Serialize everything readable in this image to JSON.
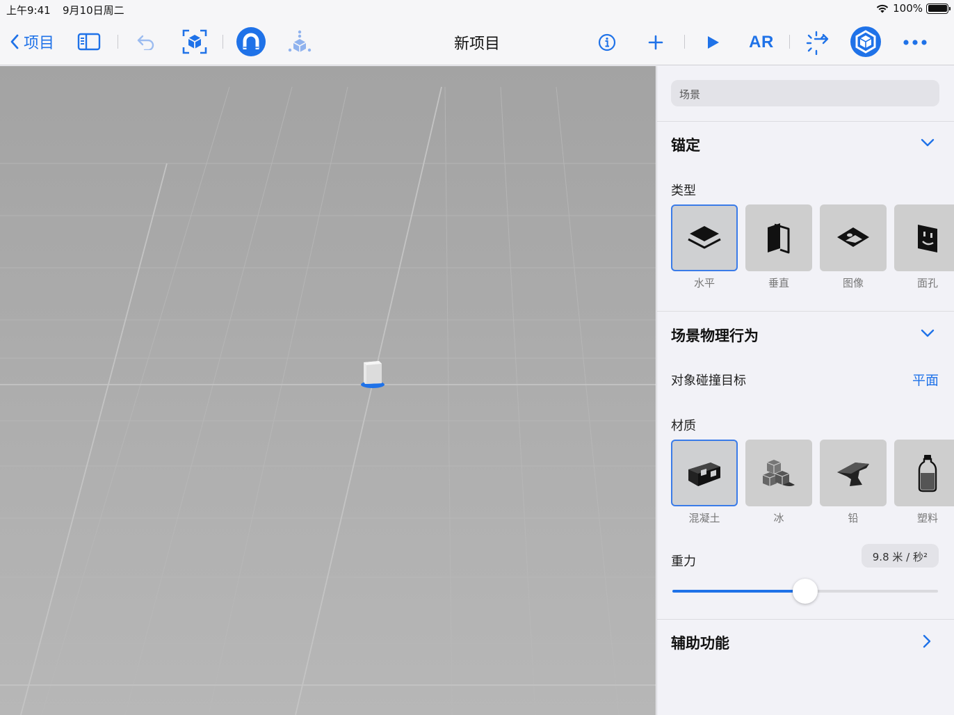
{
  "status_bar": {
    "time": "上午9:41",
    "date": "9月10日周二",
    "battery": "100%"
  },
  "toolbar": {
    "back_label": "项目",
    "title": "新项目",
    "ar_label": "AR",
    "accent": "#1f72e8"
  },
  "inspector": {
    "search_placeholder": "场景",
    "anchor_section": {
      "title": "锚定",
      "type_label": "类型",
      "types": [
        {
          "label": "水平",
          "icon": "horizontal-plane-icon",
          "selected": true
        },
        {
          "label": "垂直",
          "icon": "vertical-plane-icon",
          "selected": false
        },
        {
          "label": "图像",
          "icon": "image-anchor-icon",
          "selected": false
        },
        {
          "label": "面孔",
          "icon": "face-anchor-icon",
          "selected": false
        }
      ]
    },
    "physics_section": {
      "title": "场景物理行为",
      "collision_label": "对象碰撞目标",
      "collision_value": "平面",
      "material_label": "材质",
      "materials": [
        {
          "label": "混凝土",
          "icon": "concrete-block-icon",
          "selected": true
        },
        {
          "label": "冰",
          "icon": "ice-cubes-icon",
          "selected": false
        },
        {
          "label": "铅",
          "icon": "anvil-icon",
          "selected": false
        },
        {
          "label": "塑料",
          "icon": "plastic-bottle-icon",
          "selected": false
        }
      ],
      "gravity_label": "重力",
      "gravity_value": "9.8 米 / 秒²",
      "gravity_fraction": 0.5
    },
    "accessibility_section": {
      "title": "辅助功能"
    }
  }
}
